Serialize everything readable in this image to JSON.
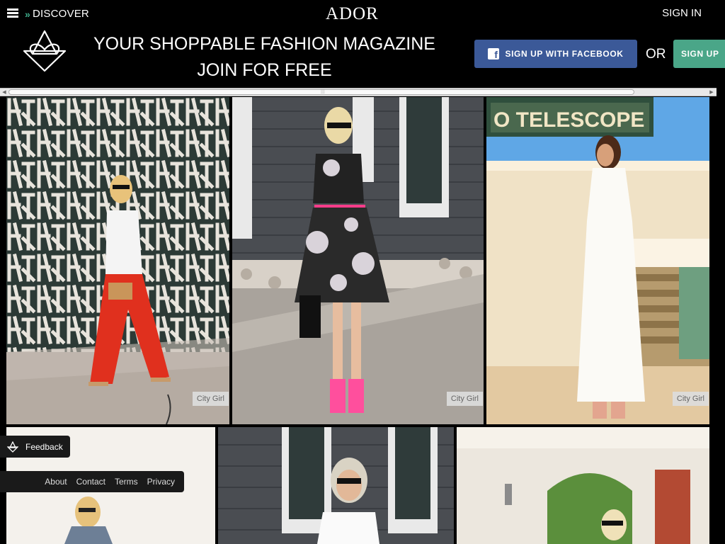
{
  "header": {
    "menu_icon": "hamburger-icon",
    "discover_label": "DISCOVER",
    "brand": "ADOR",
    "signin_label": "SIGN IN",
    "tagline_line1": "YOUR SHOPPABLE FASHION MAGAZINE",
    "tagline_line2": "JOIN FOR FREE",
    "facebook_button_label": "SIGN UP WITH FACEBOOK",
    "or_label": "OR",
    "signup_button_label": "SIGN UP",
    "colors": {
      "facebook": "#3b5998",
      "accent": "#4aa688"
    }
  },
  "tiles": [
    {
      "tag": "City Girl"
    },
    {
      "tag": "City Girl"
    },
    {
      "tag": "City Girl"
    }
  ],
  "feedback_label": "Feedback",
  "footer": {
    "links": [
      "About",
      "Contact",
      "Terms",
      "Privacy"
    ]
  }
}
